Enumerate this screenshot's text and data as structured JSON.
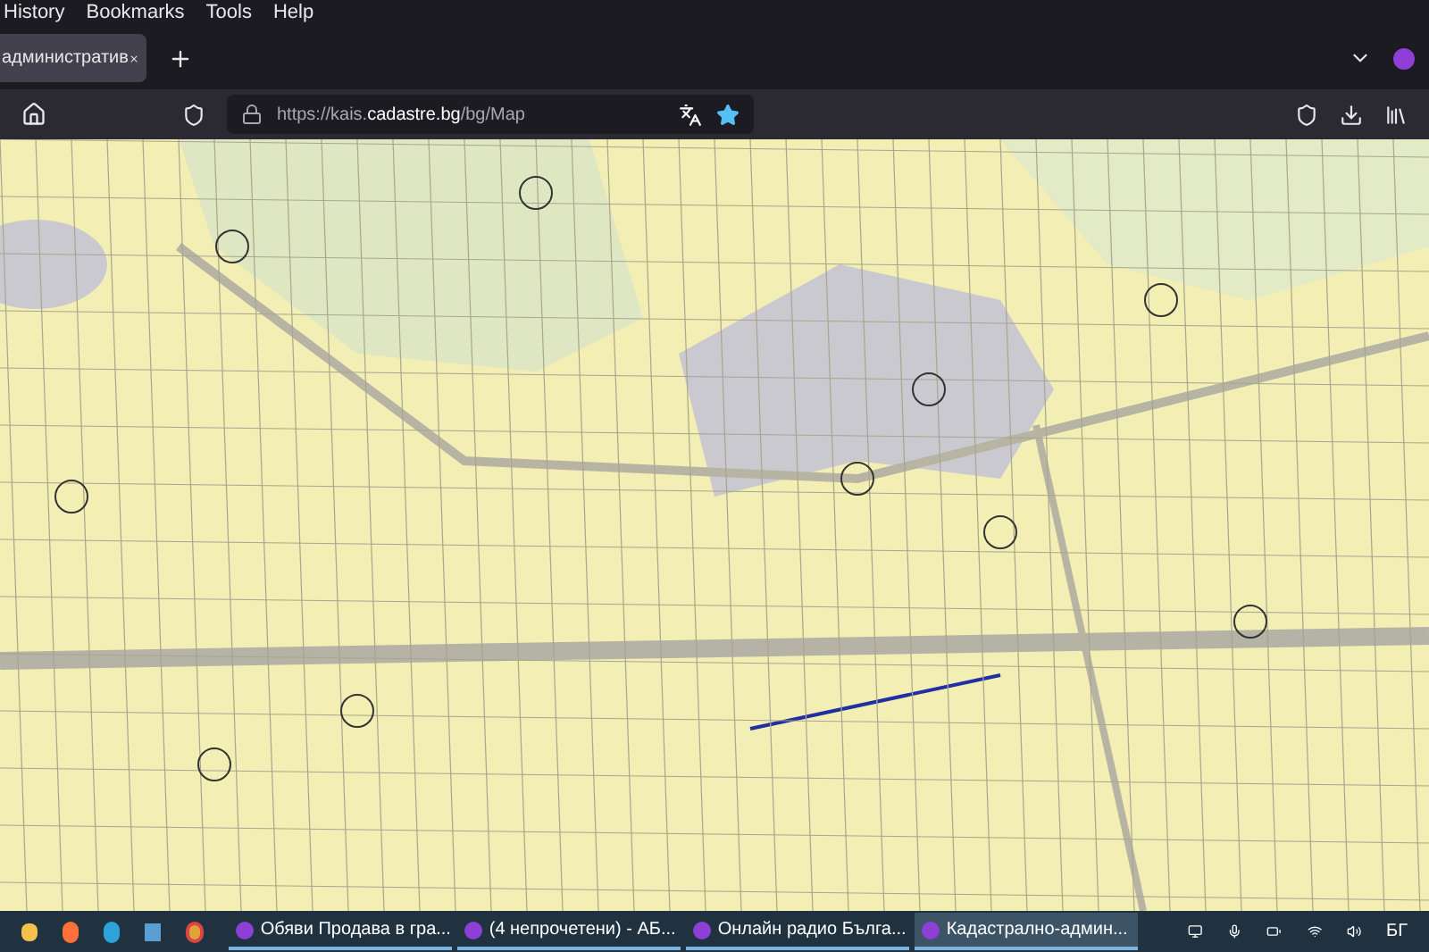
{
  "menu_bar": {
    "items": [
      "History",
      "Bookmarks",
      "Tools",
      "Help"
    ]
  },
  "tabs": [
    {
      "title": "административ",
      "selected": true
    }
  ],
  "address_bar": {
    "url": "https://kais.**cadastre.bg**/bg/Map",
    "bookmarked": true
  },
  "taskbar": {
    "windows": [
      {
        "title": "Обяви Продава в гра...",
        "selected": false
      },
      {
        "title": "(4 непрочетени) - АБ...",
        "selected": false
      },
      {
        "title": "Онлайн радио Бълга...",
        "selected": false
      },
      {
        "title": "Кадастрално-админ...",
        "selected": true
      }
    ],
    "language": "БГ"
  }
}
